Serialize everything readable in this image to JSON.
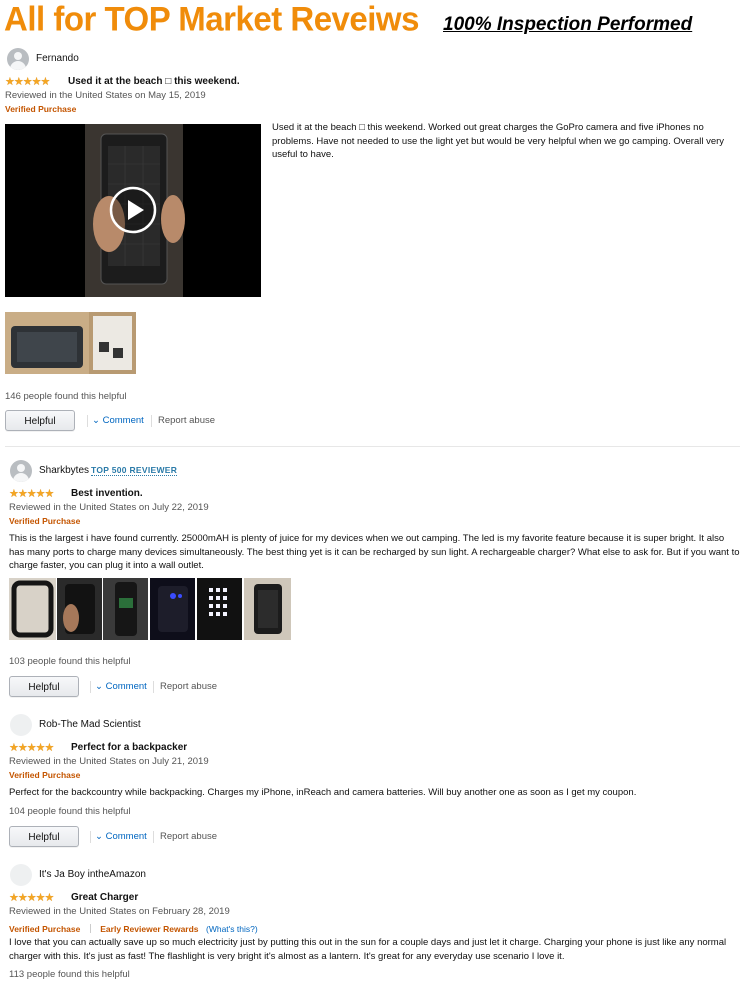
{
  "banner": {
    "title": "All for TOP Market Reveiws",
    "subtitle": "100% Inspection Performed",
    "title_color": "#f08c0a"
  },
  "reviews": [
    {
      "author": "Fernando",
      "stars": "★★★★★",
      "title": "Used it at the beach □ this weekend.",
      "date": "Reviewed in the United States on May 15, 2019",
      "verified": "Verified Purchase",
      "body": "Used it at the beach □ this weekend. Worked out great charges the GoPro camera and five iPhones no problems. Have not needed to use the light yet but would be very helpful when we go camping. Overall very useful to have.",
      "helpful_count": "146 people found this helpful",
      "media": "play-icon"
    },
    {
      "author": "Sharkbytes",
      "badge": "TOP 500 REVIEWER",
      "stars": "★★★★★",
      "title": "Best invention.",
      "date": "Reviewed in the United States on July 22, 2019",
      "verified": "Verified Purchase",
      "body": "This is the largest i have found currently. 25000mAH is plenty of juice for my devices when we out camping. The led is my favorite feature because it is super bright. It also has many ports to charge many devices simultaneously. The best thing yet is it can be recharged by sun light. A rechargeable charger? What else to ask for. But if you want to charge faster, you can plug it into a wall outlet.",
      "helpful_count": "103 people found this helpful"
    },
    {
      "author": "Rob-The Mad Scientist",
      "stars": "★★★★★",
      "title": "Perfect for a backpacker",
      "date": "Reviewed in the United States on July 21, 2019",
      "verified": "Verified Purchase",
      "body": "Perfect for the backcountry while backpacking. Charges my iPhone, inReach and camera batteries. Will buy another one as soon as I get my coupon.",
      "helpful_count": "104 people found this helpful"
    },
    {
      "author": "It's Ja Boy intheAmazon",
      "stars": "★★★★★",
      "title": "Great Charger",
      "date": "Reviewed in the United States on February 28, 2019",
      "verified": "Verified Purchase",
      "early": "Early Reviewer Rewards",
      "whats_this": "(What's this?)",
      "body": "I love that you can actually save up so much electricity just by putting this out in the sun for a couple days and just let it charge. Charging your phone is just like any normal charger with this. It's just as fast! The flashlight is very bright it's almost as a lantern. It's great for any everyday use scenario I love it.",
      "helpful_count": "113 people found this helpful"
    }
  ],
  "actions": {
    "helpful": "Helpful",
    "comment": "Comment",
    "comment_prefix": "⌄",
    "report": "Report abuse"
  },
  "colors": {
    "star": "#f5a623",
    "verified": "#c45500",
    "link": "#0066c0"
  }
}
